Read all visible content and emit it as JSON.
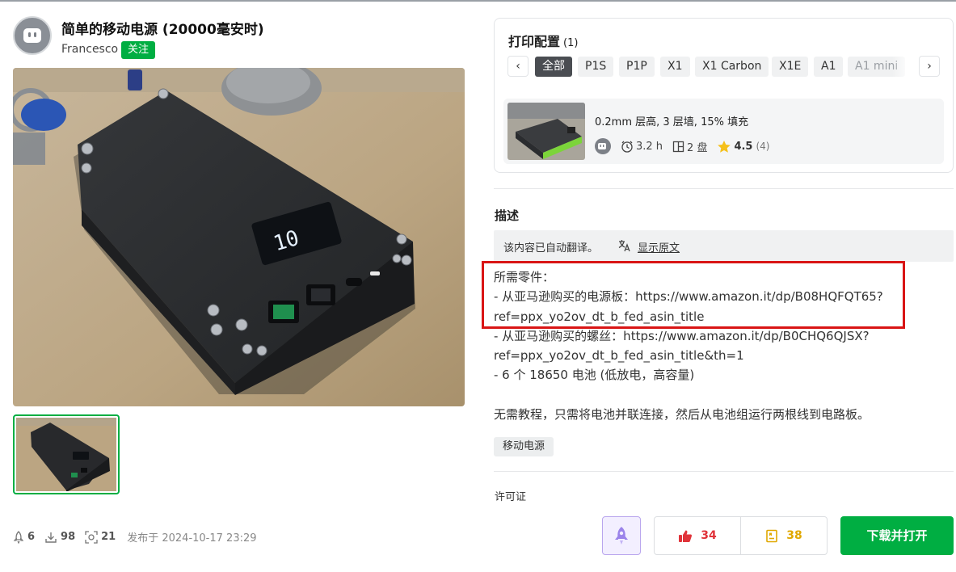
{
  "model": {
    "title": "简单的移动电源 (20000毫安时)",
    "author": "Francesco",
    "follow_label": "关注",
    "stats": {
      "boosts": "6",
      "downloads": "98",
      "prints": "21"
    },
    "published": "发布于 2024-10-17 23:29"
  },
  "print_config": {
    "title": "打印配置",
    "count": "(1)",
    "prev_icon": "chevron-left-icon",
    "next_icon": "chevron-right-icon",
    "filters": [
      "全部",
      "P1S",
      "P1P",
      "X1",
      "X1 Carbon",
      "X1E",
      "A1",
      "A1 mini"
    ],
    "active_filter": "全部",
    "profile": {
      "title": "0.2mm 层高, 3 层墙, 15% 填充",
      "time": "3.2 h",
      "plates": "2 盘",
      "rating": "4.5",
      "rating_count": "(4)"
    }
  },
  "description": {
    "heading": "描述",
    "translate_notice": "该内容已自动翻译。",
    "show_original": "显示原文",
    "lines": [
      "所需零件：",
      "- 从亚马逊购买的电源板：https://www.amazon.it/dp/B08HQFQT65?",
      "ref=ppx_yo2ov_dt_b_fed_asin_title",
      "- 从亚马逊购买的螺丝：https://www.amazon.it/dp/B0CHQ6QJSX?",
      "ref=ppx_yo2ov_dt_b_fed_asin_title&th=1",
      "- 6 个 18650 电池 (低放电，高容量)",
      "",
      "无需教程，只需将电池并联连接，然后从电池组运行两根线到电路板。"
    ],
    "tag": "移动电源",
    "license_label": "许可证"
  },
  "actions": {
    "likes": "34",
    "collects": "38",
    "download_label": "下载并打开"
  },
  "colors": {
    "accent_green": "#00ae42",
    "highlight_red": "#d91515",
    "like_red": "#e0333a",
    "collect_yellow": "#e0a800",
    "boost_purple": "#8a6ee6"
  }
}
